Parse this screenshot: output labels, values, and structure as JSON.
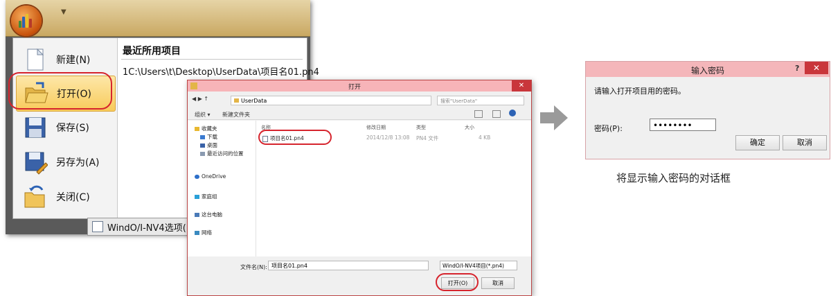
{
  "app_menu": {
    "quick_access_glyph": "▼",
    "items": [
      {
        "label": "新建(N)",
        "icon": "new-document-icon"
      },
      {
        "label": "打开(O)",
        "icon": "open-folder-icon"
      },
      {
        "label": "保存(S)",
        "icon": "save-disk-icon"
      },
      {
        "label": "另存为(A)",
        "icon": "save-as-icon"
      },
      {
        "label": "关闭(C)",
        "icon": "close-folder-icon"
      }
    ],
    "recent_title": "最近所用项目",
    "recent_item": "1C:\\Users\\t\\Desktop\\UserData\\项目名01.pn4",
    "status_text": "WindO/I-NV4选项(I"
  },
  "open_dialog": {
    "title": "打开",
    "close_glyph": "✕",
    "address": "UserData",
    "search_placeholder": "搜索\"UserData\"",
    "toolbar_organize": "组织 ▾",
    "toolbar_new_folder": "新建文件夹",
    "nav_items": [
      "收藏夹",
      "下载",
      "桌面",
      "最近访问的位置",
      "OneDrive",
      "家庭组",
      "这台电脑",
      "网络"
    ],
    "columns": [
      "名称",
      "修改日期",
      "类型",
      "大小"
    ],
    "file": {
      "name": "项目名01.pn4",
      "date": "2014/12/8 13:08",
      "type": "PN4 文件",
      "size": "4 KB"
    },
    "filename_label": "文件名(N):",
    "filename_value": "项目名01.pn4",
    "filetype_value": "WindO/I-NV4项目(*.pn4)",
    "open_button": "打开(O)",
    "cancel_button": "取消"
  },
  "password_dialog": {
    "title": "输入密码",
    "help_glyph": "?",
    "close_glyph": "✕",
    "prompt": "请输入打开项目用的密码。",
    "password_label": "密码(P):",
    "password_value": "••••••••",
    "ok_button": "确定",
    "cancel_button": "取消"
  },
  "caption": "将显示输入密码的对话框",
  "colors": {
    "highlight_ring": "#d6242d",
    "arrow": "#9a9a9a",
    "titlebar_pink": "#f4b6ba",
    "close_red": "#c9363b"
  }
}
